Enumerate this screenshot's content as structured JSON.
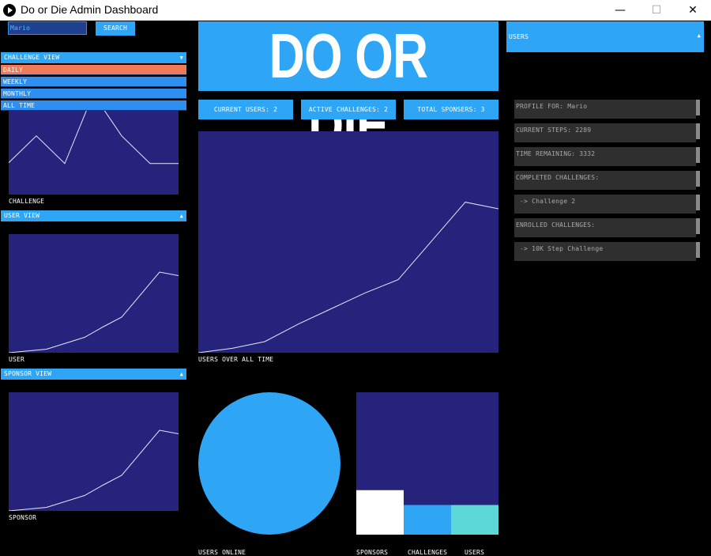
{
  "window": {
    "title": "Do or Die Admin Dashboard",
    "min": "—",
    "max": "☐",
    "close": "✕"
  },
  "search": {
    "value": "Mario",
    "button": "SEARCH"
  },
  "challenge_view": {
    "label": "CHALLENGE VIEW",
    "options": [
      "DAILY",
      "WEEKLY",
      "MONTHLY",
      "ALL TIME"
    ],
    "selected": "DAILY",
    "chart_label": "CHALLENGE"
  },
  "user_view": {
    "label": "USER VIEW",
    "chart_label": "USER"
  },
  "sponsor_view": {
    "label": "SPONSOR VIEW",
    "chart_label": "SPONSOR"
  },
  "logo": "DO OR DIE",
  "stats": {
    "current_users": "CURRENT USERS: 2",
    "active_challenges": "ACTIVE CHALLENGES: 2",
    "total_sponsors": "TOTAL SPONSERS: 3"
  },
  "main_chart_label": "USERS OVER ALL TIME",
  "pie_label": "USERS ONLINE",
  "bar_labels": [
    "SPONSORS",
    "CHALLENGES",
    "USERS"
  ],
  "users_dropdown": {
    "label": "USERS"
  },
  "profile": [
    "PROFILE FOR: Mario",
    "CURRENT STEPS: 2289",
    "TIME REMAINING: 3332",
    "COMPLETED CHALLENGES:",
    " -> Challenge 2",
    "ENROLLED CHALLENGES:",
    " -> 10K Step Challenge"
  ],
  "colors": {
    "accent": "#2ea6f5",
    "panel": "#25237c",
    "selected": "#f07a57",
    "bar_sponsors": "#ffffff",
    "bar_challenges": "#2ea6f5",
    "bar_users": "#5cd8d6"
  },
  "chart_data": [
    {
      "type": "line",
      "title": "CHALLENGE",
      "values": [
        0.38,
        0.7,
        0.37,
        1.2,
        0.7,
        0.37,
        0.37
      ]
    },
    {
      "type": "line",
      "title": "USER",
      "values": [
        0,
        0.03,
        0.13,
        0.22,
        0.3,
        0.68,
        0.65
      ]
    },
    {
      "type": "line",
      "title": "SPONSOR",
      "values": [
        0,
        0.03,
        0.13,
        0.22,
        0.3,
        0.68,
        0.65
      ]
    },
    {
      "type": "line",
      "title": "USERS OVER ALL TIME",
      "values": [
        0,
        0.02,
        0.05,
        0.13,
        0.2,
        0.27,
        0.33,
        0.68,
        0.65
      ]
    },
    {
      "type": "pie",
      "title": "USERS ONLINE",
      "values": [
        1
      ]
    },
    {
      "type": "bar",
      "categories": [
        "SPONSORS",
        "CHALLENGES",
        "USERS"
      ],
      "values": [
        3,
        2,
        2
      ]
    }
  ]
}
